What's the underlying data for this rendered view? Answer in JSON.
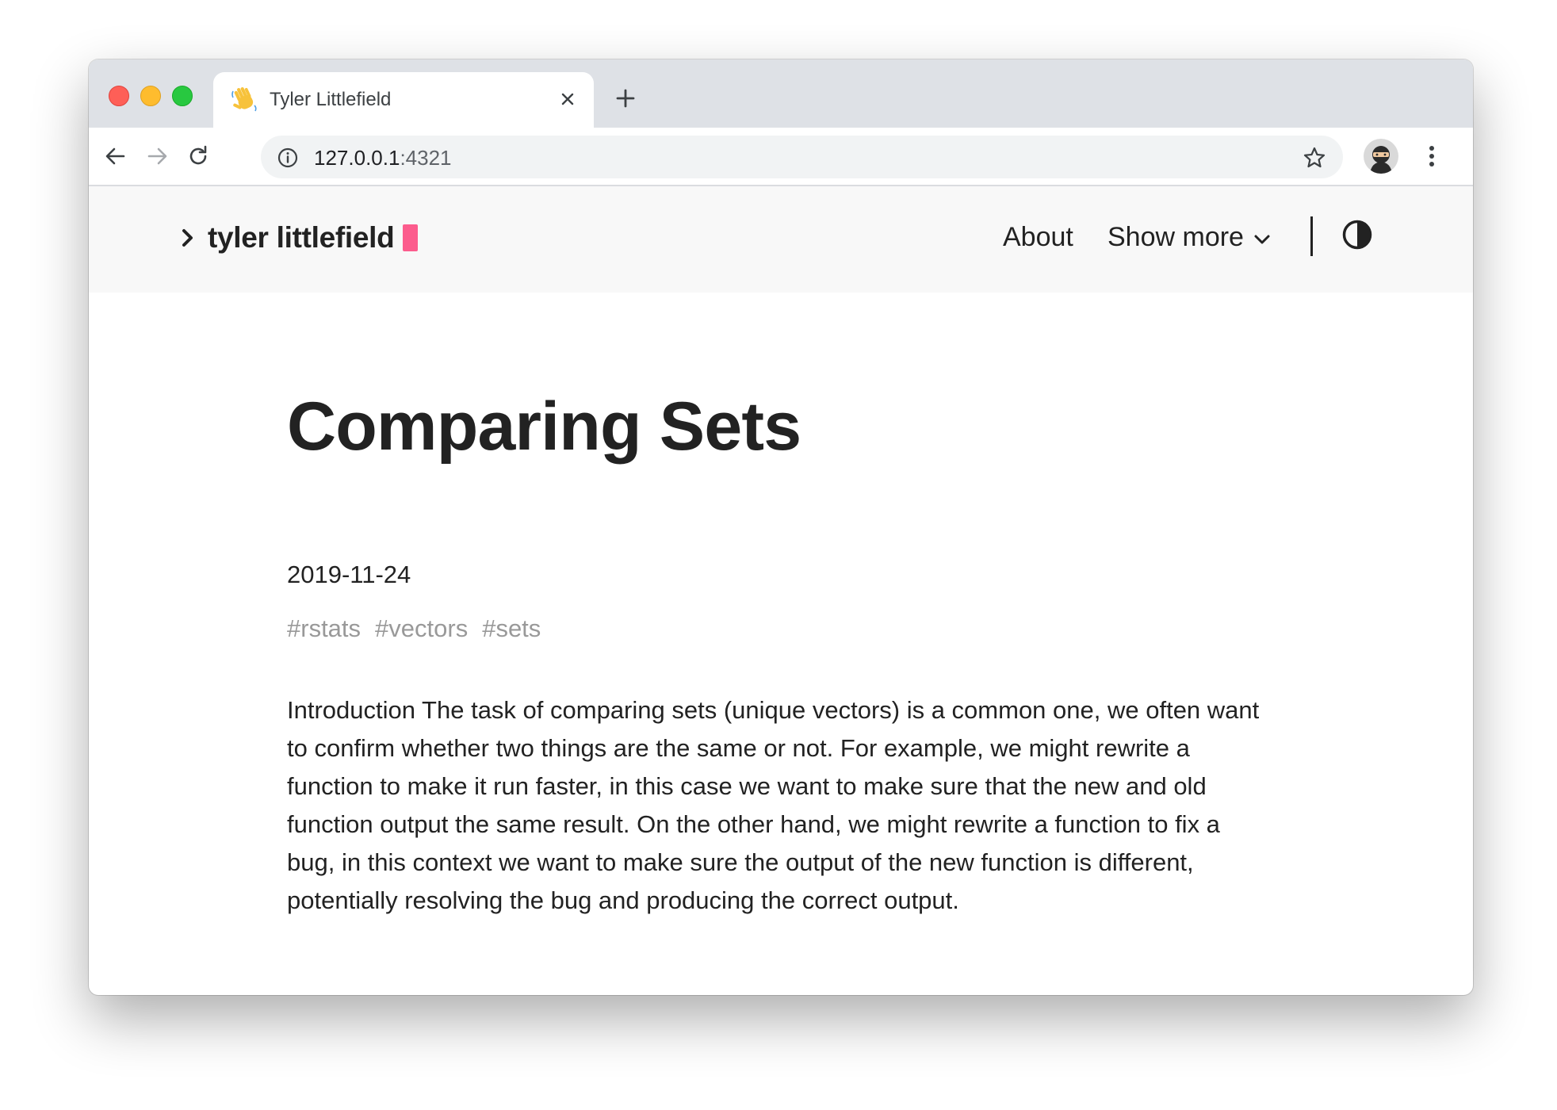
{
  "browser": {
    "tab": {
      "title": "Tyler Littlefield",
      "favicon": "waving-hand-icon"
    },
    "address_bar": {
      "host": "127.0.0.1",
      "port": ":4321"
    },
    "icons": {
      "back": "back-arrow-icon",
      "forward": "forward-arrow-icon",
      "reload": "reload-icon",
      "info": "info-icon",
      "bookmark": "star-icon",
      "profile": "avatar",
      "menu": "kebab-menu-icon",
      "close_tab": "close-icon",
      "new_tab": "plus-icon"
    }
  },
  "site": {
    "brand": {
      "text": "tyler littlefield",
      "cursor_color": "#fc5c8d"
    },
    "nav": {
      "about": "About",
      "show_more": "Show more"
    }
  },
  "article": {
    "title": "Comparing Sets",
    "date": "2019-11-24",
    "tags": [
      "#rstats",
      "#vectors",
      "#sets"
    ],
    "body": "Introduction The task of comparing sets (unique vectors) is a common one, we often want to confirm whether two things are the same or not. For example, we might rewrite a function to make it run faster, in this case we want to make sure that the new and old function output the same result. On the other hand, we might rewrite a function to fix a bug, in this context we want to make sure the output of the new function is different, potentially resolving the bug and producing the correct output."
  },
  "colors": {
    "accent": "#fc5c8d",
    "text": "#222222",
    "tag": "#999999",
    "header_bg": "#f8f8f8",
    "tabstrip_bg": "#dee1e6"
  }
}
